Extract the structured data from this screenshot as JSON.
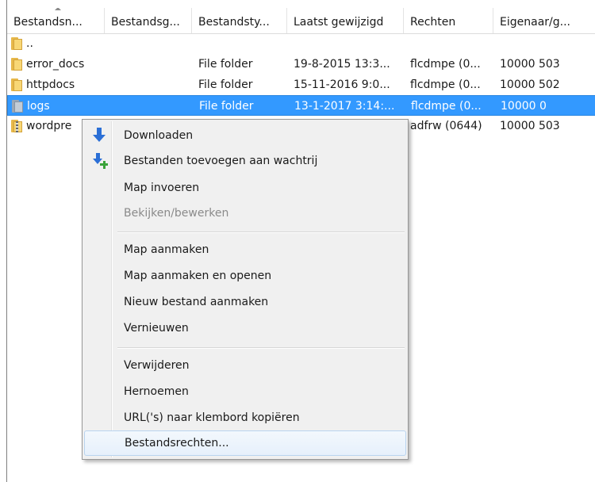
{
  "columns": [
    {
      "label": "Bestandsn...",
      "width": 123
    },
    {
      "label": "Bestandsg...",
      "width": 110
    },
    {
      "label": "Bestandsty...",
      "width": 120
    },
    {
      "label": "Laatst gewijzigd",
      "width": 147
    },
    {
      "label": "Rechten",
      "width": 113
    },
    {
      "label": "Eigenaar/g...",
      "width": 129
    }
  ],
  "rows": [
    {
      "name": "..",
      "type": "",
      "modified": "",
      "perms": "",
      "owner": "",
      "icon": "folder-icon"
    },
    {
      "name": "error_docs",
      "type": "File folder",
      "modified": "19-8-2015 13:3...",
      "perms": "flcdmpe (0...",
      "owner": "10000 503",
      "icon": "folder-icon"
    },
    {
      "name": "httpdocs",
      "type": "File folder",
      "modified": "15-11-2016 9:0...",
      "perms": "flcdmpe (0...",
      "owner": "10000 502",
      "icon": "folder-icon"
    },
    {
      "name": "logs",
      "type": "File folder",
      "modified": "13-1-2017 3:14:...",
      "perms": "flcdmpe (0...",
      "owner": "10000 0",
      "icon": "folder-icon",
      "selected": true
    },
    {
      "name": "wordpre",
      "type": "",
      "modified": "",
      "perms": "adfrw (0644)",
      "owner": "10000 503",
      "icon": "zip-folder-icon"
    }
  ],
  "menu": {
    "items": [
      {
        "label": "Downloaden",
        "icon": "download-arrow-icon"
      },
      {
        "label": "Bestanden toevoegen aan wachtrij",
        "icon": "add-to-queue-icon"
      },
      {
        "label": "Map invoeren"
      },
      {
        "label": "Bekijken/bewerken",
        "disabled": true
      },
      {
        "separator": true
      },
      {
        "label": "Map aanmaken"
      },
      {
        "label": "Map aanmaken en openen"
      },
      {
        "label": "Nieuw bestand aanmaken"
      },
      {
        "label": "Vernieuwen"
      },
      {
        "separator": true
      },
      {
        "label": "Verwijderen"
      },
      {
        "label": "Hernoemen"
      },
      {
        "label": "URL('s) naar klembord kopiëren"
      },
      {
        "label": "Bestandsrechten...",
        "hover": true
      }
    ]
  },
  "colors": {
    "selection": "#3399ff",
    "menu_background": "#f0f0f0",
    "download_arrow": "#2b6fd6",
    "plus": "#3aa33a"
  }
}
